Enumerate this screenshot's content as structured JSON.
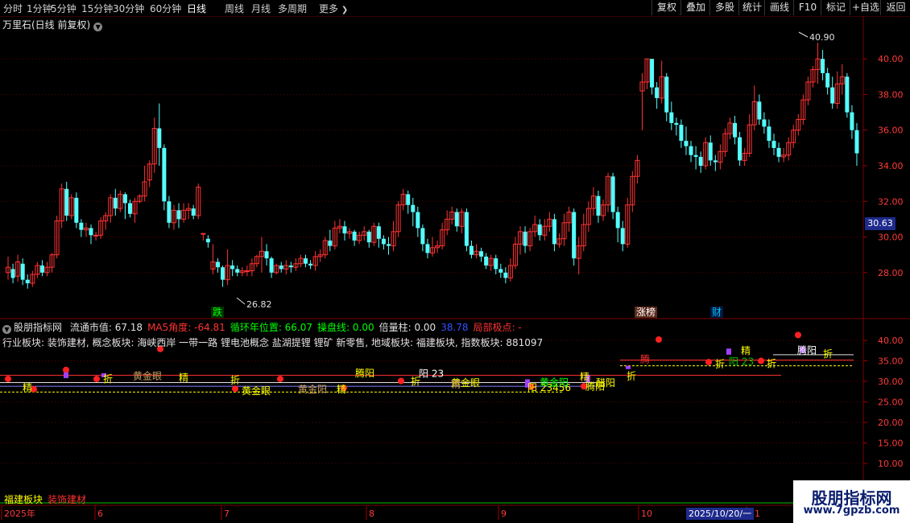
{
  "toolbar": {
    "periods": [
      "分时",
      "1分钟",
      "5分钟",
      "15分钟",
      "30分钟",
      "60分钟",
      "日线",
      "周线",
      "月线",
      "多周期",
      "更多"
    ],
    "active_period": "日线",
    "more_icon": "chevron-right-icon",
    "right_buttons": [
      "复权",
      "叠加",
      "多股",
      "统计",
      "画线",
      "F10",
      "标记",
      "+自选",
      "返回"
    ]
  },
  "chart_title": {
    "text": "万里石(日线 前复权)",
    "icon": "chevron-down-icon"
  },
  "main_chart": {
    "axis_labels": [
      "40.00",
      "38.00",
      "36.00",
      "34.00",
      "32.00",
      "30.00",
      "28.00"
    ],
    "current_price": "30.63",
    "high_marker": "40.90",
    "low_marker": "26.82",
    "event_labels": [
      {
        "text": "跌",
        "color": "#00ff00",
        "bg": "#003300"
      },
      {
        "text": "涨榜",
        "color": "#ffffff",
        "bg": "#5a2a1a"
      },
      {
        "text": "财",
        "color": "#00c0ff",
        "bg": "#001a40"
      }
    ]
  },
  "indicator": {
    "name": "股朋指标网",
    "fields": [
      {
        "label": "流通市值: 67.18",
        "color": "#e0e0e0"
      },
      {
        "label": "MA5角度: -64.81",
        "color": "#ff3333"
      },
      {
        "label": "循环年位置: 66.07",
        "color": "#00ff00"
      },
      {
        "label": "操盘线: 0.00",
        "color": "#00ff00"
      },
      {
        "label": "倍量柱: 0.00",
        "color": "#e0e0e0"
      },
      {
        "label": "38.78",
        "color": "#3050ff"
      },
      {
        "label": "局部极点: -",
        "color": "#ff3333"
      }
    ],
    "sectors": "行业板块: 装饰建材, 概念板块: 海峡西岸 一带一路 锂电池概念 盐湖提锂 锂矿 新零售, 地域板块: 福建板块, 指数板块: 881097",
    "axis_labels": [
      "40.00",
      "35.00",
      "30.00",
      "25.00",
      "20.00",
      "15.00",
      "10.00"
    ],
    "annotations": [
      "精",
      "折",
      "黄金眼",
      "精",
      "折",
      "黄金眼",
      "黄金阳",
      "精",
      "腾阳",
      "阳 23",
      "折",
      "黄金眼",
      "精",
      "阳 23456",
      "黄金阳",
      "腾阳",
      "折",
      "精",
      "折",
      "精",
      "阳 23",
      "折",
      "腾阳",
      "折",
      "醋阳",
      "腾"
    ],
    "bottom_labels": {
      "yellow": "福建板块",
      "red": "装饰建材"
    }
  },
  "x_axis": {
    "labels": [
      "2025年",
      "6",
      "7",
      "8",
      "9",
      "10",
      "11"
    ],
    "cursor_date": "2025/10/20/一"
  },
  "watermark": {
    "title": "股朋指标网",
    "url": "www.7gpzb.com"
  },
  "colors": {
    "up": "#ff3333",
    "down": "#54ffff",
    "grid": "#5a0000",
    "axis_text": "#ff3a3a"
  },
  "chart_data": {
    "type": "candlestick",
    "y_range": [
      26.5,
      41.5
    ],
    "candles": [
      [
        28.0,
        28.3,
        27.6,
        28.9
      ],
      [
        28.2,
        27.7,
        27.4,
        28.5
      ],
      [
        27.8,
        28.6,
        27.5,
        29.0
      ],
      [
        28.5,
        27.6,
        27.3,
        28.8
      ],
      [
        27.6,
        27.4,
        27.1,
        27.9
      ],
      [
        27.4,
        27.9,
        27.2,
        28.1
      ],
      [
        27.9,
        28.4,
        27.7,
        28.6
      ],
      [
        28.4,
        28.0,
        27.8,
        28.7
      ],
      [
        28.0,
        28.3,
        27.8,
        28.6
      ],
      [
        28.3,
        29.0,
        28.0,
        29.1
      ],
      [
        29.0,
        30.9,
        28.8,
        31.2
      ],
      [
        30.9,
        32.7,
        30.5,
        33.0
      ],
      [
        32.7,
        31.2,
        30.9,
        33.1
      ],
      [
        31.2,
        32.2,
        31.0,
        32.4
      ],
      [
        32.2,
        30.8,
        30.5,
        32.5
      ],
      [
        30.8,
        30.4,
        30.0,
        31.0
      ],
      [
        30.4,
        30.5,
        30.0,
        30.8
      ],
      [
        30.5,
        30.1,
        29.6,
        30.7
      ],
      [
        30.1,
        30.1,
        29.8,
        30.3
      ],
      [
        30.1,
        30.9,
        29.9,
        31.1
      ],
      [
        30.9,
        31.2,
        30.4,
        31.4
      ],
      [
        31.2,
        32.2,
        30.8,
        32.4
      ],
      [
        32.2,
        31.6,
        31.2,
        32.7
      ],
      [
        31.6,
        32.4,
        31.4,
        32.6
      ],
      [
        32.4,
        31.9,
        31.0,
        32.5
      ],
      [
        31.9,
        31.3,
        31.1,
        32.1
      ],
      [
        31.3,
        32.0,
        30.8,
        32.2
      ],
      [
        32.0,
        32.3,
        31.9,
        32.4
      ],
      [
        32.3,
        33.1,
        32.0,
        34.0
      ],
      [
        33.2,
        34.1,
        32.8,
        34.3
      ],
      [
        34.1,
        36.1,
        33.6,
        36.7
      ],
      [
        36.1,
        35.0,
        34.0,
        37.5
      ],
      [
        35.0,
        32.0,
        31.5,
        35.2
      ],
      [
        32.0,
        30.8,
        30.5,
        32.3
      ],
      [
        30.8,
        31.5,
        30.4,
        31.8
      ],
      [
        31.5,
        31.0,
        30.5,
        31.9
      ],
      [
        31.0,
        31.5,
        30.8,
        31.9
      ],
      [
        31.5,
        31.6,
        31.0,
        31.9
      ],
      [
        31.6,
        31.2,
        31.0,
        31.8
      ],
      [
        31.2,
        32.8,
        31.0,
        33.0
      ],
      [
        30.2,
        30.2,
        29.8,
        30.2
      ],
      [
        29.9,
        29.7,
        29.4,
        30.1
      ],
      [
        28.2,
        28.6,
        27.9,
        29.6
      ],
      [
        28.6,
        28.3,
        28.0,
        28.8
      ],
      [
        28.3,
        27.6,
        27.2,
        28.4
      ],
      [
        27.6,
        28.4,
        27.3,
        29.3
      ],
      [
        28.4,
        28.2,
        27.8,
        28.7
      ],
      [
        28.2,
        28.0,
        27.8,
        28.4
      ],
      [
        28.0,
        28.1,
        27.8,
        28.3
      ],
      [
        28.1,
        28.1,
        27.8,
        28.4
      ],
      [
        28.1,
        28.5,
        27.8,
        28.8
      ],
      [
        28.5,
        28.9,
        28.3,
        29.0
      ],
      [
        28.9,
        29.2,
        28.0,
        30.0
      ],
      [
        29.2,
        28.8,
        28.4,
        29.6
      ],
      [
        28.8,
        28.0,
        27.7,
        28.9
      ],
      [
        28.0,
        28.4,
        27.9,
        28.5
      ],
      [
        28.4,
        28.2,
        28.0,
        28.6
      ],
      [
        28.2,
        28.4,
        27.9,
        28.7
      ],
      [
        28.4,
        28.3,
        28.0,
        28.6
      ],
      [
        28.3,
        28.5,
        28.1,
        28.8
      ],
      [
        28.5,
        28.8,
        28.3,
        29.0
      ],
      [
        28.8,
        28.5,
        28.3,
        29.0
      ],
      [
        28.5,
        28.4,
        28.2,
        28.7
      ],
      [
        28.4,
        28.9,
        28.1,
        29.2
      ],
      [
        28.9,
        29.0,
        28.6,
        29.3
      ],
      [
        29.0,
        29.8,
        28.8,
        30.0
      ],
      [
        29.8,
        29.5,
        29.2,
        30.4
      ],
      [
        29.5,
        30.5,
        29.3,
        30.9
      ],
      [
        30.5,
        30.6,
        30.2,
        31.0
      ],
      [
        30.6,
        30.2,
        29.8,
        30.9
      ],
      [
        30.2,
        30.3,
        29.9,
        30.5
      ],
      [
        30.3,
        29.8,
        29.5,
        30.4
      ],
      [
        29.8,
        30.1,
        29.6,
        30.3
      ],
      [
        30.1,
        30.3,
        29.8,
        30.6
      ],
      [
        30.3,
        29.7,
        29.4,
        30.4
      ],
      [
        29.7,
        30.6,
        29.5,
        30.8
      ],
      [
        30.6,
        29.9,
        29.4,
        30.8
      ],
      [
        29.9,
        29.6,
        29.3,
        30.1
      ],
      [
        29.6,
        29.5,
        29.0,
        30.0
      ],
      [
        29.5,
        30.3,
        29.2,
        30.9
      ],
      [
        30.3,
        31.8,
        30.0,
        32.0
      ],
      [
        31.8,
        32.4,
        31.5,
        32.7
      ],
      [
        32.4,
        31.8,
        31.3,
        32.6
      ],
      [
        31.8,
        31.4,
        30.6,
        32.2
      ],
      [
        31.4,
        30.5,
        30.0,
        31.7
      ],
      [
        30.5,
        29.6,
        29.2,
        30.7
      ],
      [
        29.6,
        29.1,
        28.8,
        29.9
      ],
      [
        29.1,
        29.4,
        28.9,
        30.0
      ],
      [
        29.4,
        29.5,
        29.1,
        29.8
      ],
      [
        29.5,
        30.4,
        29.3,
        30.8
      ],
      [
        30.4,
        31.0,
        30.1,
        31.5
      ],
      [
        31.0,
        31.4,
        30.7,
        31.7
      ],
      [
        31.4,
        30.6,
        30.3,
        31.6
      ],
      [
        30.6,
        31.4,
        30.2,
        31.6
      ],
      [
        31.4,
        29.5,
        29.2,
        31.6
      ],
      [
        29.5,
        29.0,
        28.8,
        29.8
      ],
      [
        29.0,
        29.2,
        28.8,
        29.6
      ],
      [
        29.2,
        28.9,
        28.6,
        29.4
      ],
      [
        28.9,
        28.4,
        28.2,
        29.1
      ],
      [
        28.4,
        28.8,
        28.1,
        29.0
      ],
      [
        28.8,
        28.2,
        27.9,
        29.0
      ],
      [
        28.2,
        28.0,
        27.7,
        28.5
      ],
      [
        28.0,
        27.7,
        27.4,
        28.3
      ],
      [
        27.7,
        28.4,
        27.5,
        28.8
      ],
      [
        28.4,
        29.6,
        28.2,
        30.0
      ],
      [
        29.6,
        30.3,
        29.0,
        30.6
      ],
      [
        30.3,
        29.5,
        29.1,
        30.6
      ],
      [
        29.5,
        30.3,
        29.2,
        30.5
      ],
      [
        30.3,
        30.7,
        30.0,
        31.2
      ],
      [
        30.7,
        30.1,
        29.8,
        31.0
      ],
      [
        30.1,
        30.6,
        29.8,
        31.0
      ],
      [
        30.6,
        31.0,
        30.3,
        31.4
      ],
      [
        31.0,
        29.6,
        29.2,
        31.3
      ],
      [
        29.6,
        29.9,
        29.4,
        30.2
      ],
      [
        29.9,
        30.8,
        29.5,
        31.3
      ],
      [
        30.8,
        31.4,
        30.3,
        31.7
      ],
      [
        31.4,
        28.8,
        28.4,
        31.6
      ],
      [
        28.8,
        29.5,
        27.9,
        30.0
      ],
      [
        29.5,
        30.7,
        29.2,
        31.3
      ],
      [
        30.7,
        31.6,
        30.3,
        32.0
      ],
      [
        31.6,
        32.3,
        31.2,
        32.8
      ],
      [
        32.3,
        31.2,
        30.8,
        32.6
      ],
      [
        31.2,
        31.8,
        30.9,
        32.1
      ],
      [
        31.8,
        33.4,
        31.4,
        33.6
      ],
      [
        33.4,
        31.4,
        31.0,
        33.6
      ],
      [
        31.4,
        30.5,
        29.7,
        31.7
      ],
      [
        30.5,
        29.6,
        29.2,
        30.9
      ],
      [
        29.6,
        31.8,
        29.4,
        32.2
      ],
      [
        31.8,
        33.4,
        31.4,
        33.7
      ],
      [
        33.4,
        34.3,
        33.0,
        34.6
      ],
      [
        38.2,
        38.7,
        36.0,
        39.2
      ],
      [
        38.7,
        40.0,
        38.3,
        40.0
      ],
      [
        40.0,
        38.4,
        38.0,
        40.0
      ],
      [
        38.4,
        37.8,
        37.2,
        38.7
      ],
      [
        37.8,
        39.0,
        37.5,
        39.9
      ],
      [
        39.0,
        37.0,
        36.5,
        39.2
      ],
      [
        37.0,
        36.4,
        36.0,
        37.6
      ],
      [
        36.4,
        36.3,
        35.7,
        36.7
      ],
      [
        36.3,
        35.4,
        35.0,
        36.6
      ],
      [
        35.4,
        35.1,
        34.6,
        36.2
      ],
      [
        35.1,
        34.6,
        34.2,
        35.4
      ],
      [
        34.6,
        34.5,
        33.8,
        35.1
      ],
      [
        34.5,
        34.0,
        33.6,
        34.8
      ],
      [
        34.0,
        35.3,
        33.8,
        35.6
      ],
      [
        35.3,
        34.3,
        34.0,
        35.7
      ],
      [
        34.3,
        34.2,
        33.7,
        34.6
      ],
      [
        34.2,
        34.8,
        33.8,
        35.2
      ],
      [
        34.8,
        35.8,
        34.5,
        36.1
      ],
      [
        35.8,
        36.4,
        35.5,
        36.7
      ],
      [
        36.4,
        35.6,
        35.2,
        36.8
      ],
      [
        35.6,
        34.3,
        34.0,
        35.9
      ],
      [
        34.3,
        34.7,
        34.0,
        35.0
      ],
      [
        34.7,
        36.3,
        34.5,
        36.9
      ],
      [
        36.3,
        37.6,
        36.0,
        38.5
      ],
      [
        37.6,
        36.6,
        36.3,
        38.0
      ],
      [
        36.6,
        36.2,
        35.8,
        37.0
      ],
      [
        36.2,
        35.4,
        35.0,
        36.6
      ],
      [
        35.4,
        35.0,
        34.6,
        35.8
      ],
      [
        35.0,
        34.5,
        34.2,
        35.3
      ],
      [
        34.5,
        34.6,
        34.2,
        35.0
      ],
      [
        34.6,
        35.3,
        34.3,
        35.6
      ],
      [
        35.3,
        36.0,
        35.0,
        36.3
      ],
      [
        36.0,
        36.6,
        35.7,
        36.9
      ],
      [
        36.6,
        37.7,
        36.3,
        38.0
      ],
      [
        37.7,
        38.7,
        37.4,
        39.0
      ],
      [
        38.7,
        39.4,
        38.4,
        39.6
      ],
      [
        39.4,
        40.0,
        38.6,
        40.9
      ],
      [
        40.0,
        39.2,
        38.8,
        40.5
      ],
      [
        39.2,
        38.4,
        38.0,
        39.5
      ],
      [
        38.4,
        37.5,
        37.2,
        39.0
      ],
      [
        37.5,
        38.6,
        37.2,
        39.3
      ],
      [
        38.6,
        39.0,
        38.0,
        39.7
      ],
      [
        39.0,
        37.0,
        36.7,
        39.2
      ],
      [
        37.0,
        36.0,
        35.5,
        37.4
      ],
      [
        36.0,
        34.7,
        34.0,
        36.4
      ]
    ]
  }
}
